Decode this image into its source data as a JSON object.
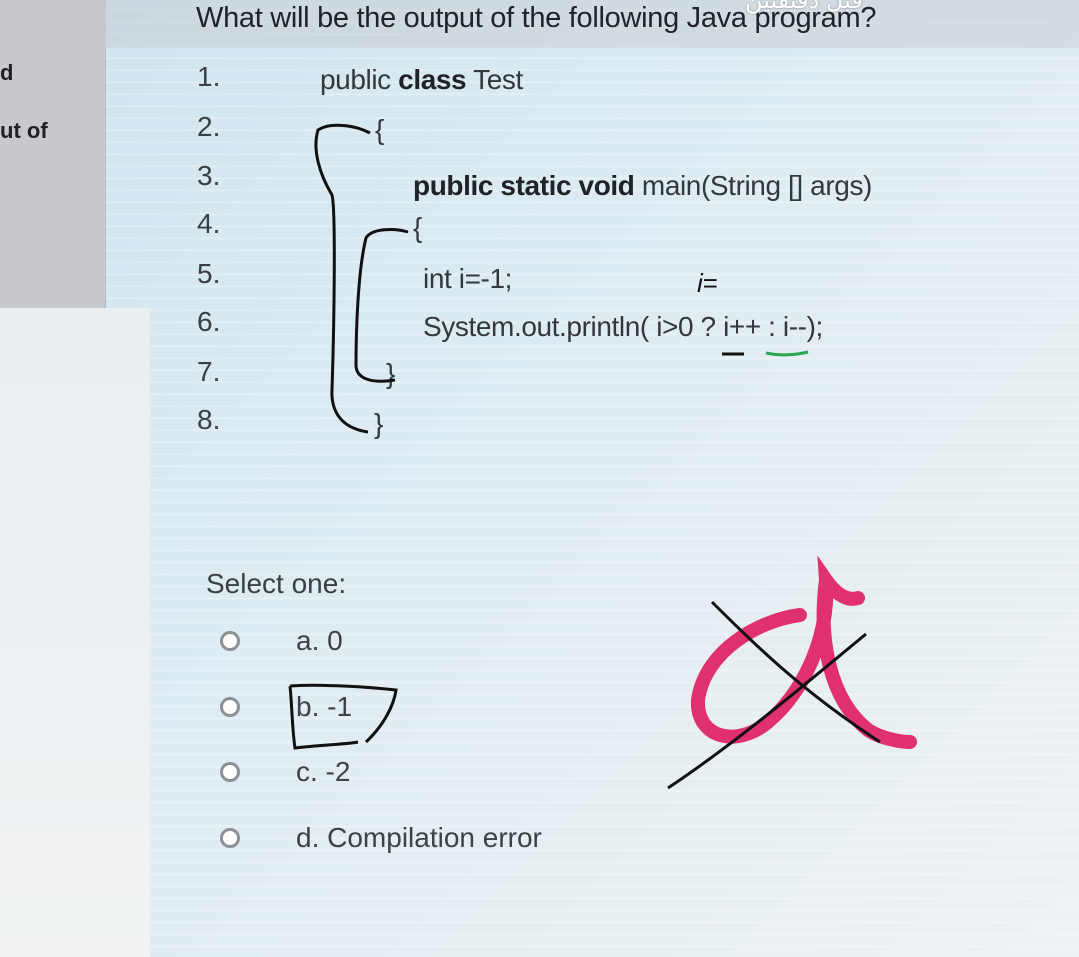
{
  "header": {
    "question": "What will be the output of the following Java program?",
    "overlay_text": "قبل دقيقتين"
  },
  "side_fragment": {
    "line1": "d",
    "line2": "ut of"
  },
  "code_lines": [
    {
      "number": "1.",
      "pre": "public ",
      "kw": "class",
      "post": " Test"
    },
    {
      "number": "2.",
      "text": "{"
    },
    {
      "number": "3.",
      "kw1": "public static void",
      "post": " main(String [] args)"
    },
    {
      "number": "4.",
      "text": "{"
    },
    {
      "number": "5.",
      "text": "int i=-1;"
    },
    {
      "number": "6.",
      "text": "System.out.println( i>0 ? i++ : i--);"
    },
    {
      "number": "7.",
      "text": "}"
    },
    {
      "number": "8.",
      "text": "}"
    }
  ],
  "annotation_text": "i=",
  "select_label": "Select one:",
  "options": [
    {
      "label": "a. 0",
      "selected": false
    },
    {
      "label": "b. -1",
      "selected": false
    },
    {
      "label": "c. -2",
      "selected": false
    },
    {
      "label": "d. Compilation error",
      "selected": false
    }
  ],
  "marks": {
    "pink_letter": "a",
    "pink_color": "#e0306f",
    "ink_color": "#111111",
    "green_underline_color": "#2aa84a"
  }
}
